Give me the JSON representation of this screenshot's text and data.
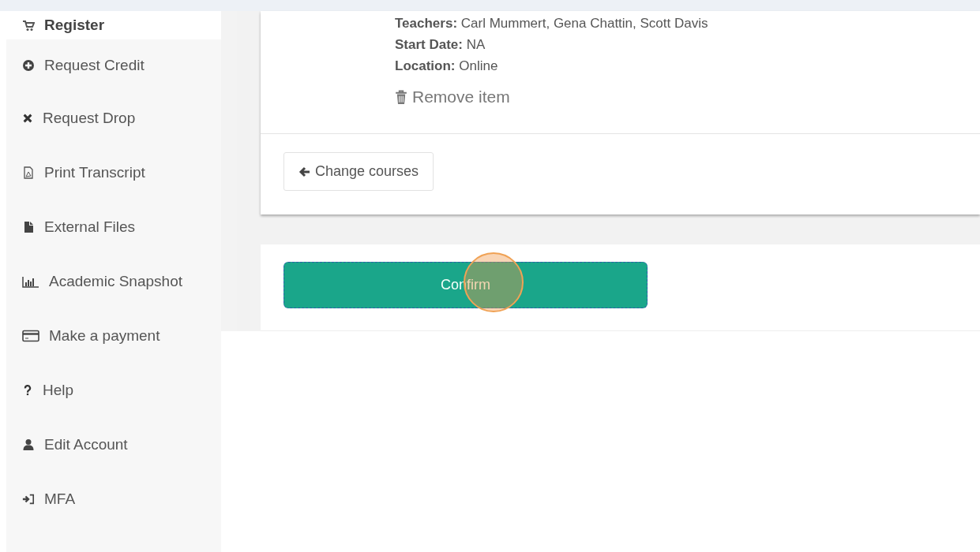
{
  "sidebar": {
    "items": [
      {
        "label": "Register",
        "selected": true
      },
      {
        "label": "Request Credit",
        "selected": false
      },
      {
        "label": "Request Drop",
        "selected": false
      },
      {
        "label": "Print Transcript",
        "selected": false
      },
      {
        "label": "External Files",
        "selected": false
      },
      {
        "label": "Academic Snapshot",
        "selected": false
      },
      {
        "label": "Make a payment",
        "selected": false
      },
      {
        "label": "Help",
        "selected": false
      },
      {
        "label": "Edit Account",
        "selected": false
      },
      {
        "label": "MFA",
        "selected": false
      }
    ]
  },
  "course": {
    "details": [
      {
        "label": "Teachers:",
        "value": "Carl Mummert, Gena Chattin, Scott Davis"
      },
      {
        "label": "Start Date:",
        "value": "NA"
      },
      {
        "label": "Location:",
        "value": "Online"
      }
    ],
    "remove_action": "Remove item",
    "back_button": "Change courses"
  },
  "confirm_button": "Confirm"
}
